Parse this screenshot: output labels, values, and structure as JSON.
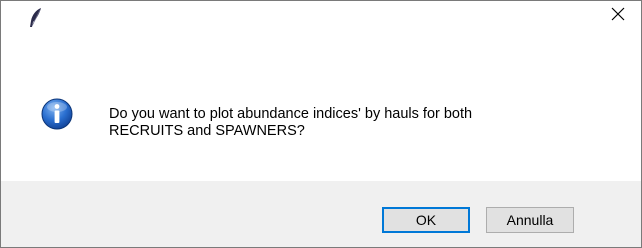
{
  "window": {
    "app_icon": "feather-icon",
    "close_icon": "close-icon"
  },
  "dialog": {
    "icon": "info-icon",
    "message": "Do you want to plot abundance indices' by hauls for both\nRECRUITS and SPAWNERS?"
  },
  "buttons": {
    "ok_label": "OK",
    "cancel_label": "Annulla"
  },
  "colors": {
    "footer_bg": "#f0f0f0",
    "focus_border": "#0078d7",
    "button_bg": "#e1e1e1",
    "info_blue": "#1f5fbf"
  }
}
